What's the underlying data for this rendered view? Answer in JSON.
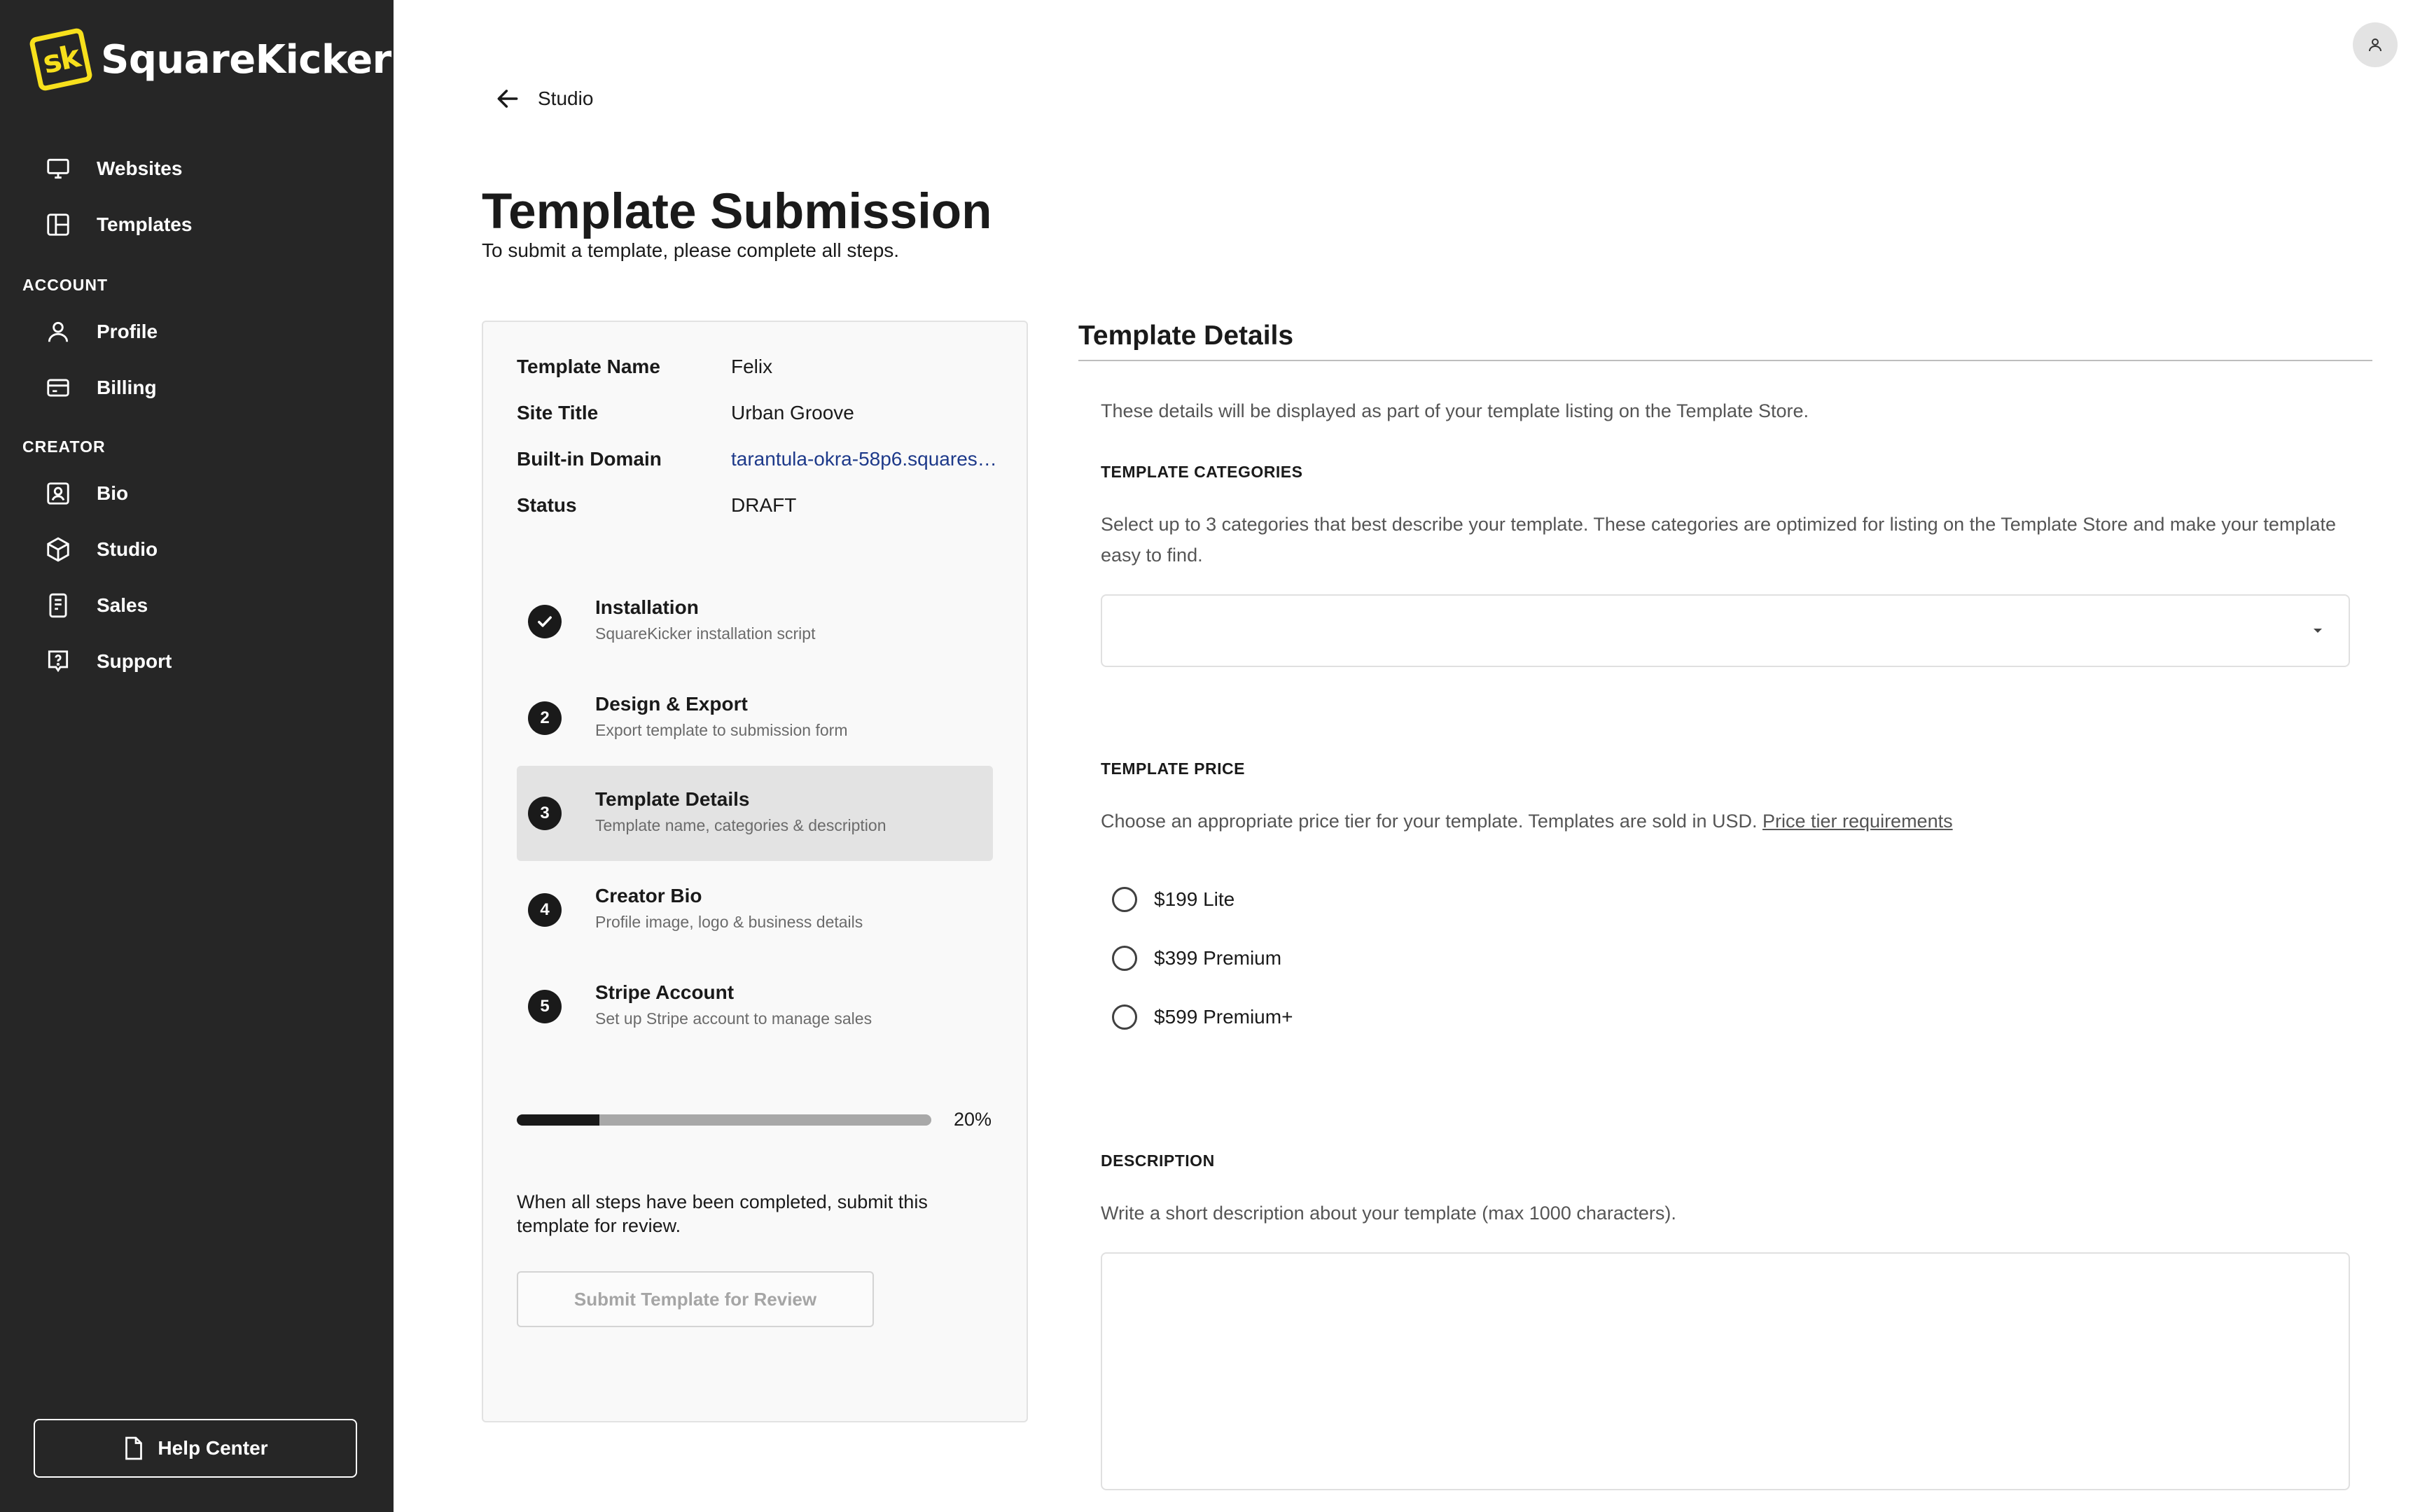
{
  "app": {
    "brand": "SquareKicker",
    "logo_mark": "sk",
    "brand_color": "#f7e01c"
  },
  "sidebar": {
    "items_top": [
      {
        "label": "Websites",
        "icon": "monitor-icon"
      },
      {
        "label": "Templates",
        "icon": "layout-icon"
      }
    ],
    "sections": [
      {
        "title": "ACCOUNT",
        "items": [
          {
            "label": "Profile",
            "icon": "user-icon"
          },
          {
            "label": "Billing",
            "icon": "credit-card-icon"
          }
        ]
      },
      {
        "title": "CREATOR",
        "items": [
          {
            "label": "Bio",
            "icon": "id-badge-icon"
          },
          {
            "label": "Studio",
            "icon": "cube-icon"
          },
          {
            "label": "Sales",
            "icon": "receipt-icon"
          },
          {
            "label": "Support",
            "icon": "help-bubble-icon"
          }
        ]
      }
    ],
    "help_center": "Help Center"
  },
  "header": {
    "back_label": "Studio",
    "title": "Template Submission",
    "subtitle": "To submit a template, please complete all steps."
  },
  "summary": {
    "rows": [
      {
        "label": "Template Name",
        "value": "Felix"
      },
      {
        "label": "Site Title",
        "value": "Urban Groove"
      },
      {
        "label": "Built-in Domain",
        "value": "tarantula-okra-58p6.squarespace.com"
      },
      {
        "label": "Status",
        "value": "DRAFT"
      }
    ]
  },
  "steps": [
    {
      "badge": "",
      "title": "Installation",
      "desc": "SquareKicker installation script",
      "state": "complete"
    },
    {
      "badge": "2",
      "title": "Design & Export",
      "desc": "Export template to submission form",
      "state": "pending"
    },
    {
      "badge": "3",
      "title": "Template Details",
      "desc": "Template name, categories & description",
      "state": "active"
    },
    {
      "badge": "4",
      "title": "Creator Bio",
      "desc": "Profile image, logo & business details",
      "state": "pending"
    },
    {
      "badge": "5",
      "title": "Stripe Account",
      "desc": "Set up Stripe account to manage sales",
      "state": "pending"
    }
  ],
  "progress": {
    "value": 20,
    "label": "20%"
  },
  "card": {
    "note": "When all steps have been completed, submit this template for review.",
    "submit_label": "Submit Template for Review"
  },
  "details": {
    "title": "Template Details",
    "intro": "These details will be displayed as part of your template listing on the Template Store.",
    "categories": {
      "label": "TEMPLATE CATEGORIES",
      "help": "Select up to 3 categories that best describe your template. These categories are optimized for listing on the Template Store and make your template easy to find.",
      "selected": ""
    },
    "price": {
      "label": "TEMPLATE PRICE",
      "help": "Choose an appropriate price tier for your template. Templates are sold in USD.",
      "link": "Price tier requirements",
      "options": [
        "$199 Lite",
        "$399 Premium",
        "$599 Premium+"
      ]
    },
    "description": {
      "label": "DESCRIPTION",
      "help": "Write a short description about your template (max 1000 characters).",
      "value": ""
    }
  }
}
